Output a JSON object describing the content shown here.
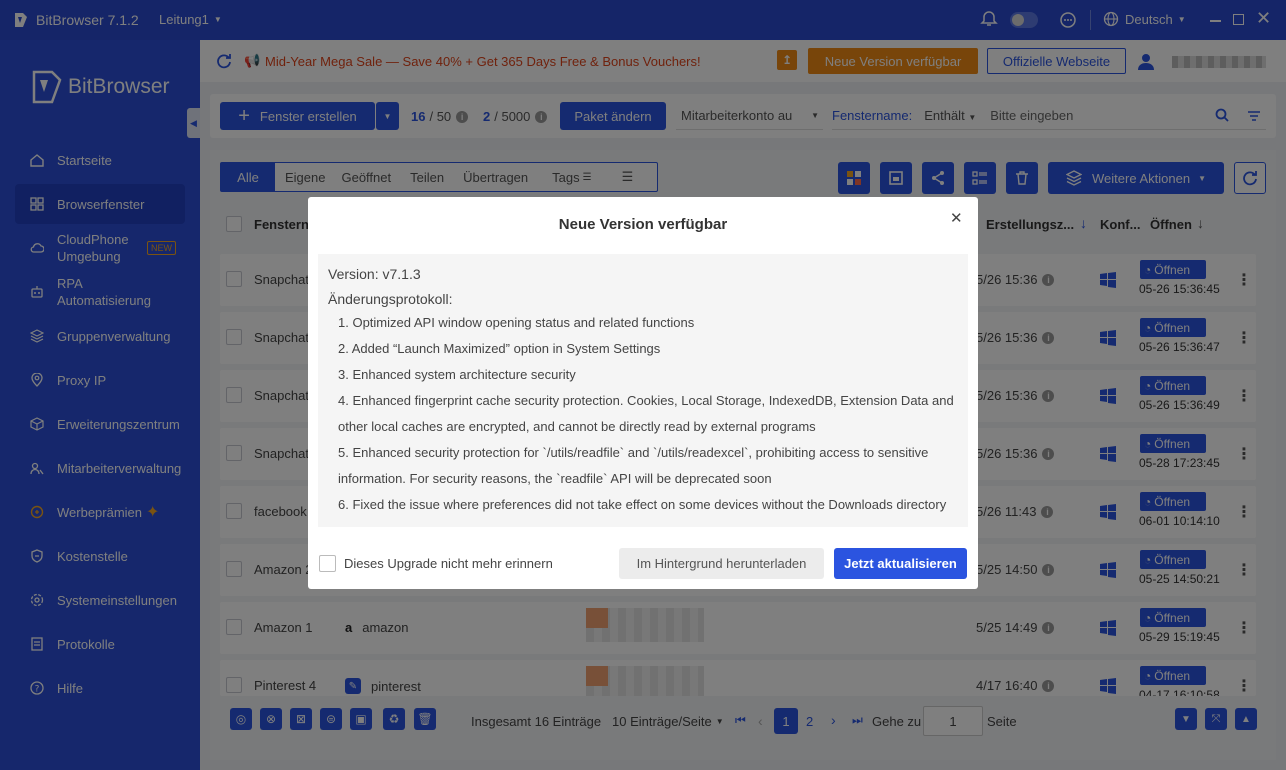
{
  "titlebar": {
    "app_title": "BitBrowser 7.1.2",
    "workspace": "Leitung1",
    "language": "Deutsch"
  },
  "sidebar": {
    "logo_text": "BitBrowser",
    "items": [
      {
        "label": "Startseite",
        "icon": "home-icon"
      },
      {
        "label": "Browserfenster",
        "icon": "grid-icon",
        "active": true
      },
      {
        "label": "CloudPhone Umgebung",
        "icon": "cloud-icon",
        "badge": "NEW"
      },
      {
        "label": "RPA Automatisierung",
        "icon": "robot-icon"
      },
      {
        "label": "Gruppenverwaltung",
        "icon": "layers-icon"
      },
      {
        "label": "Proxy IP",
        "icon": "location-icon"
      },
      {
        "label": "Erweiterungszentrum",
        "icon": "cube-icon"
      },
      {
        "label": "Mitarbeiterverwaltung",
        "icon": "users-icon"
      },
      {
        "label": "Werbeprämien",
        "icon": "gift-icon"
      },
      {
        "label": "Kostenstelle",
        "icon": "shield-icon"
      },
      {
        "label": "Systemeinstellungen",
        "icon": "gear-icon"
      },
      {
        "label": "Protokolle",
        "icon": "log-icon"
      },
      {
        "label": "Hilfe",
        "icon": "help-icon"
      }
    ]
  },
  "promo": {
    "text": "Mid-Year Mega Sale — Save 40% + Get 365 Days Free & Bonus Vouchers!",
    "update_button": "Neue Version verfügbar",
    "website_button": "Offizielle Webseite"
  },
  "toolbar": {
    "create_button": "Fenster erstellen",
    "window_count": "16",
    "window_limit": "/ 50",
    "member_count": "2",
    "member_limit": "/ 5000",
    "package_button": "Paket ändern",
    "member_select": "Mitarbeiterkonto au",
    "filter_label": "Fenstername:",
    "filter_mode": "Enthält",
    "filter_placeholder": "Bitte eingeben"
  },
  "tabs": [
    "Alle",
    "Eigene",
    "Geöffnet",
    "Teilen",
    "Übertragen",
    "Tags"
  ],
  "actions": {
    "more_button": "Weitere Aktionen"
  },
  "table": {
    "headers": {
      "name": "Fenstern...",
      "created": "Erstellungsz...",
      "config": "Konf...",
      "open": "Öffnen"
    },
    "open_label": "Öffnen",
    "rows": [
      {
        "name": "Snapchat",
        "platform": "",
        "date": "5/26 15:36",
        "opened": "05-26 15:36:45"
      },
      {
        "name": "Snapchat",
        "platform": "",
        "date": "5/26 15:36",
        "opened": "05-26 15:36:47"
      },
      {
        "name": "Snapchat",
        "platform": "",
        "date": "5/26 15:36",
        "opened": "05-26 15:36:49"
      },
      {
        "name": "Snapchat",
        "platform": "",
        "date": "5/26 15:36",
        "opened": "05-28 17:23:45"
      },
      {
        "name": "facebook",
        "platform": "",
        "date": "5/26 11:43",
        "opened": "06-01 10:14:10"
      },
      {
        "name": "Amazon 2",
        "platform": "",
        "date": "5/25 14:50",
        "opened": "05-25 14:50:21"
      },
      {
        "name": "Amazon 1",
        "platform": "amazon",
        "date": "5/25 14:49",
        "opened": "05-29 15:19:45"
      },
      {
        "name": "Pinterest 4",
        "platform": "pinterest",
        "date": "4/17 16:40",
        "opened": "04-17 16:10:58"
      }
    ]
  },
  "pagination": {
    "total": "Insgesamt 16 Einträge",
    "per_page": "10 Einträge/Seite",
    "page1": "1",
    "page2": "2",
    "goto_label": "Gehe zu",
    "goto_value": "1",
    "page_suffix": "Seite"
  },
  "modal": {
    "title": "Neue Version verfügbar",
    "version": "Version:  v7.1.3",
    "changelog_title": "Änderungsprotokoll:",
    "changes": [
      "1. Optimized API window opening status and related functions",
      "2. Added “Launch Maximized” option in System Settings",
      "3. Enhanced system architecture security",
      "4. Enhanced fingerprint cache security protection. Cookies, Local Storage, IndexedDB, Extension Data and",
      "other local caches are encrypted, and cannot be directly read by external programs",
      "5. Enhanced security protection for `/utils/readfile` and `/utils/readexcel`, prohibiting access to sensitive",
      "information. For security reasons, the `readfile` API will be deprecated soon",
      "6. Fixed the issue where preferences did not take effect on some devices without the Downloads directory"
    ],
    "dont_remind": "Dieses Upgrade nicht mehr erinnern",
    "background_button": "Im Hintergrund herunterladen",
    "update_button": "Jetzt aktualisieren"
  },
  "colors": {
    "primary": "#2b54e0",
    "sidebar": "#2c4fd8",
    "promo_orange": "#f08a14",
    "promo_text": "#e0441b"
  }
}
